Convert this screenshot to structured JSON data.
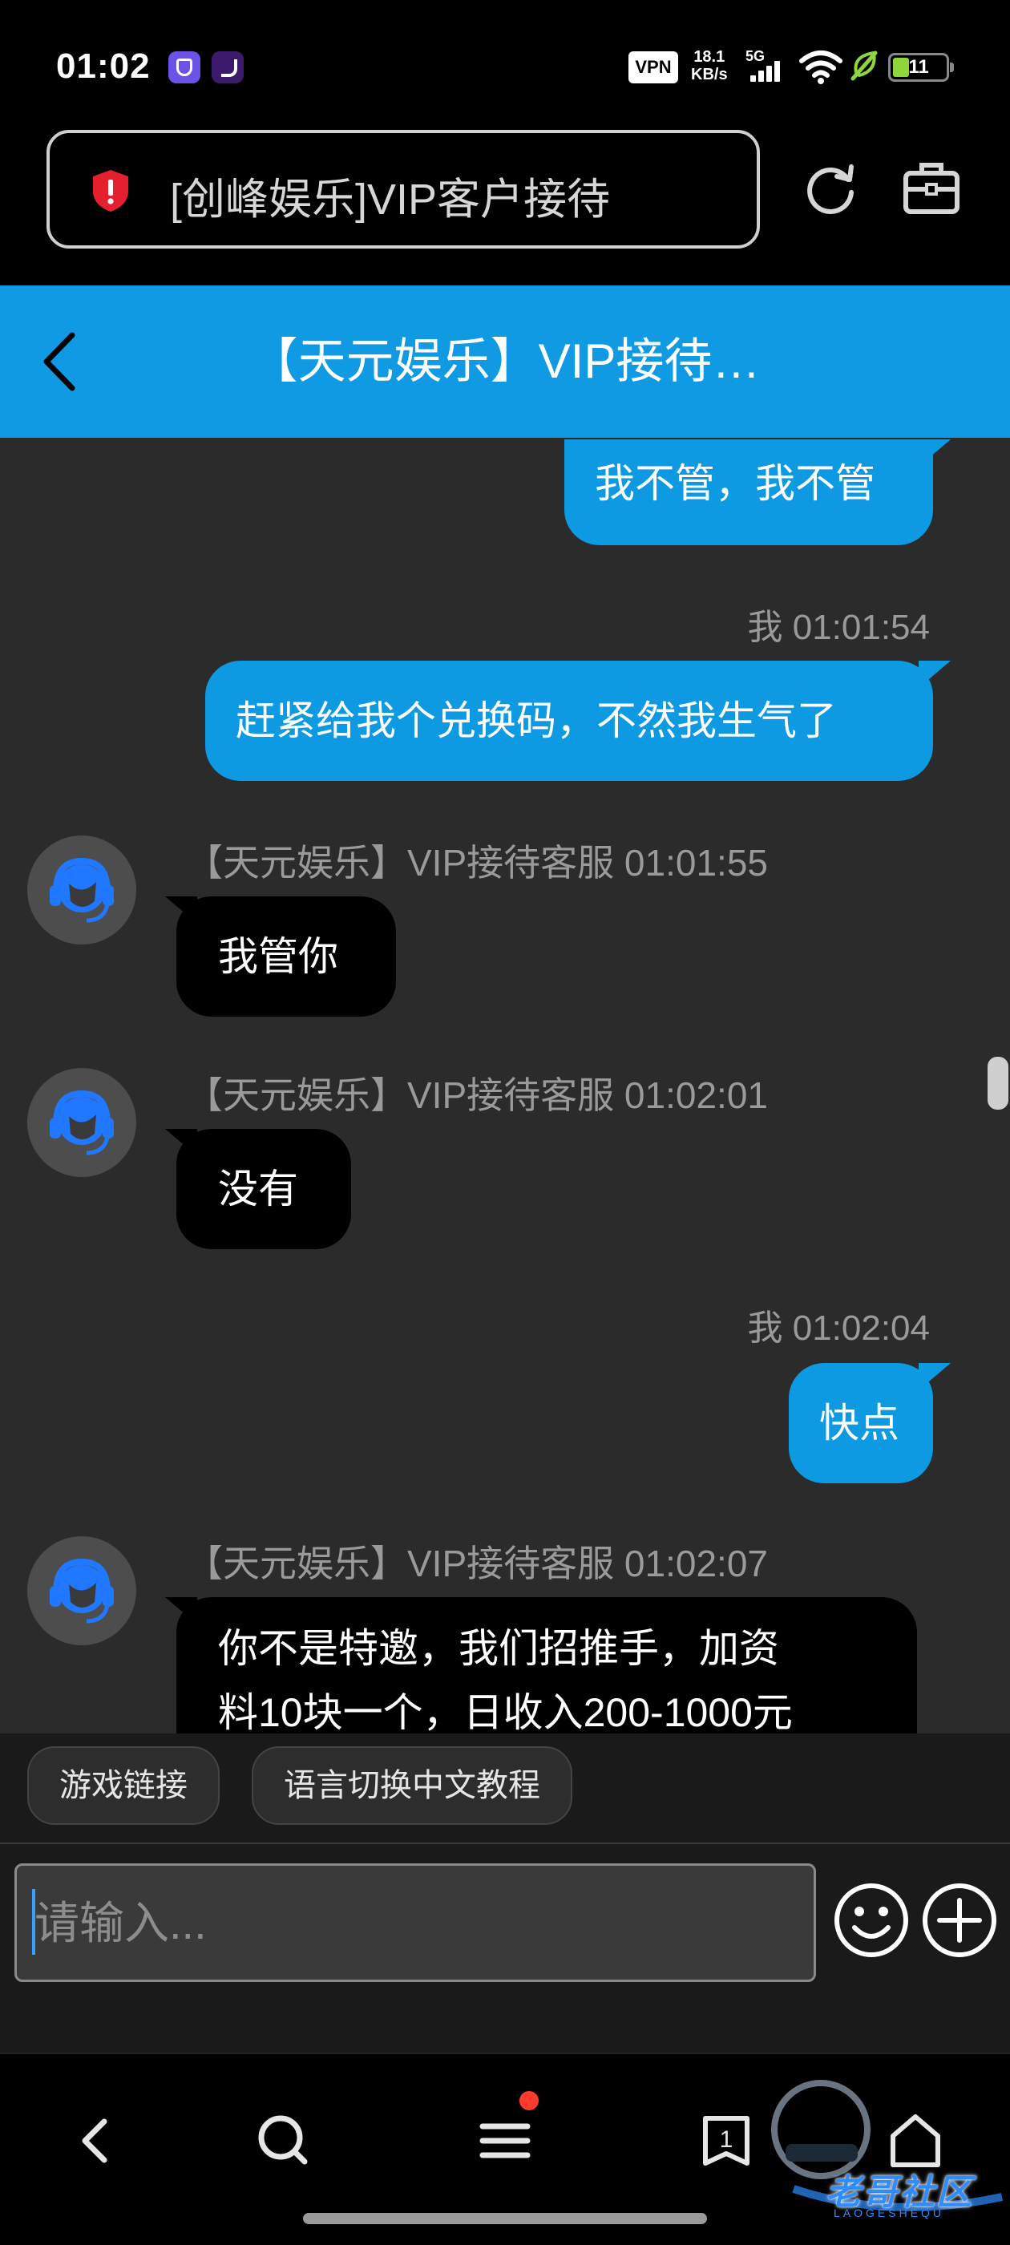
{
  "status_bar": {
    "time": "01:02",
    "vpn": "VPN",
    "speed_value": "18.1",
    "speed_unit": "KB/s",
    "network": "5G",
    "battery": "11"
  },
  "browser": {
    "url_title": "[创峰娱乐]VIP客户接待"
  },
  "chat": {
    "title": "【天元娱乐】VIP接待…",
    "messages": [
      {
        "from": "me",
        "text": "我不管，我不管"
      },
      {
        "from": "me",
        "meta": "我 01:01:54",
        "text": "赶紧给我个兑换码，不然我生气了"
      },
      {
        "from": "agent",
        "meta": "【天元娱乐】VIP接待客服 01:01:55",
        "text": "我管你"
      },
      {
        "from": "agent",
        "meta": "【天元娱乐】VIP接待客服 01:02:01",
        "text": "没有"
      },
      {
        "from": "me",
        "meta": "我 01:02:04",
        "text": "快点"
      },
      {
        "from": "agent",
        "meta": "【天元娱乐】VIP接待客服 01:02:07",
        "line1": "你不是特邀，我们招推手，加资",
        "line2": "料10块一个，日收入200-1000元"
      }
    ]
  },
  "quick_replies": [
    "游戏链接",
    "语言切换中文教程"
  ],
  "input": {
    "placeholder": "请输入..."
  },
  "watermark": {
    "text": "老哥社区",
    "sub": "LAOGESHEQU"
  },
  "colors": {
    "accent": "#0e9ae2",
    "header": "#0f9ae3",
    "chat_bg": "#2b2b2b",
    "agent_bubble": "#000000"
  },
  "icons": [
    "shield-alert-icon",
    "reload-icon",
    "toolbox-icon",
    "back-chevron-icon",
    "agent-avatar-icon",
    "emoji-icon",
    "plus-icon",
    "nav-back-icon",
    "nav-search-icon",
    "nav-menu-icon",
    "nav-tabs-icon",
    "nav-home-icon"
  ]
}
